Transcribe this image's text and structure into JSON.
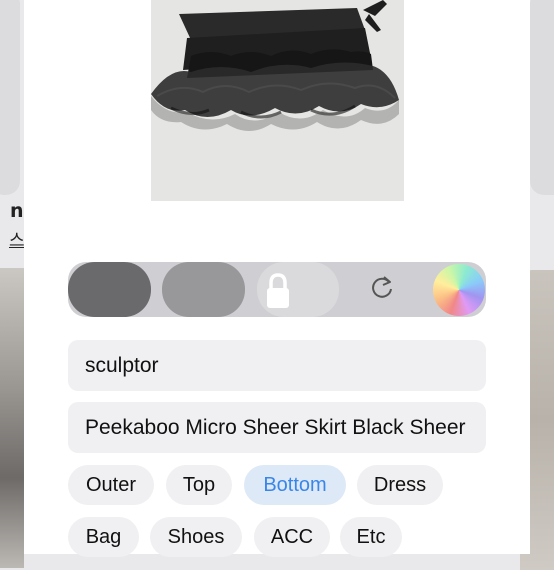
{
  "background": {
    "letter": "n",
    "korean_char": "스"
  },
  "toolbar": {
    "swatches": [
      {
        "icon": "dark-gray-swatch",
        "color": "#6a6a6c"
      },
      {
        "icon": "gray-swatch",
        "color": "#98989b"
      }
    ],
    "lock_icon": "lock-icon",
    "rotate_icon": "rotate-icon",
    "color_picker_icon": "color-wheel-icon"
  },
  "form": {
    "brand_value": "sculptor",
    "name_value": "Peekaboo Micro Sheer Skirt Black Sheer"
  },
  "categories": {
    "selected": "Bottom",
    "row1": [
      "Outer",
      "Top",
      "Bottom",
      "Dress"
    ],
    "row2": [
      "Bag",
      "Shoes",
      "ACC",
      "Etc"
    ]
  },
  "colors": {
    "selected_chip_bg": "#dde9f7",
    "selected_chip_text": "#3a86e8"
  }
}
